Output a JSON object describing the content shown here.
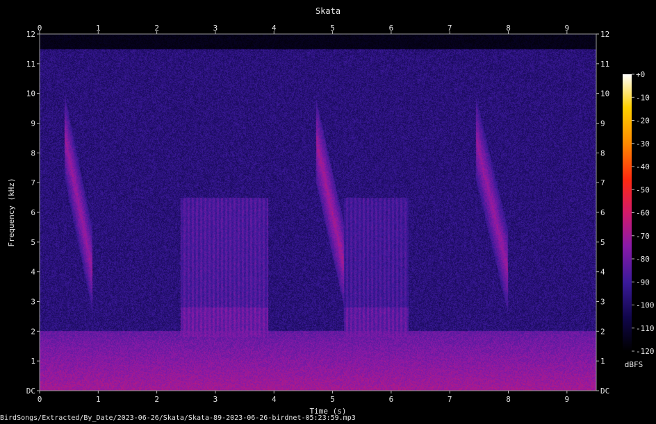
{
  "chart_data": {
    "type": "heatmap",
    "title": "Skata",
    "xlabel": "Time (s)",
    "ylabel": "Frequency (kHz)",
    "x_ticks": [
      "0",
      "1",
      "2",
      "3",
      "4",
      "5",
      "6",
      "7",
      "8",
      "9"
    ],
    "y_ticks": [
      "DC",
      "1",
      "2",
      "3",
      "4",
      "5",
      "6",
      "7",
      "8",
      "9",
      "10",
      "11",
      "12"
    ],
    "xlim": [
      0,
      9.5
    ],
    "ylim": [
      0,
      12
    ],
    "colorbar": {
      "label": "dBFS",
      "ticks": [
        "+0",
        "-10",
        "-20",
        "-30",
        "-40",
        "-50",
        "-60",
        "-70",
        "-80",
        "-90",
        "-100",
        "-110",
        "-120"
      ],
      "range": [
        -120,
        0
      ]
    },
    "colors": {
      "background": "#000000",
      "cmap": [
        "#000000",
        "#10064a",
        "#3b1a9a",
        "#8a1aa8",
        "#d21a6a",
        "#ff2a10",
        "#ff8a00",
        "#ffd000",
        "#ffffff"
      ]
    },
    "calls": [
      {
        "t0": 0.42,
        "t1": 0.9,
        "f_hi": 8.6,
        "f_lo": 4.0,
        "level": -72
      },
      {
        "t0": 4.72,
        "t1": 5.2,
        "f_hi": 8.4,
        "f_lo": 4.2,
        "level": -70
      },
      {
        "t0": 7.45,
        "t1": 8.0,
        "f_hi": 8.5,
        "f_lo": 4.0,
        "level": -72
      }
    ],
    "bands": [
      {
        "t0": 2.4,
        "t1": 3.9,
        "f_lo": 1.8,
        "f_hi": 6.5,
        "level": -88
      },
      {
        "t0": 5.2,
        "t1": 6.3,
        "f_lo": 1.8,
        "f_hi": 6.5,
        "level": -90
      }
    ],
    "noise_floor_level": -96,
    "low_freq_band": {
      "f_hi": 2.0,
      "level": -82
    }
  },
  "footer": {
    "path": "BirdSongs/Extracted/By_Date/2023-06-26/Skata/Skata-89-2023-06-26-birdnet-05:23:59.mp3"
  }
}
